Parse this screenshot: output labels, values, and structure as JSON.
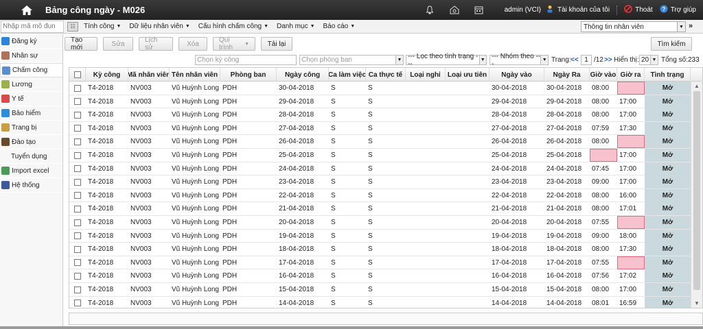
{
  "title": "Bảng công ngày - M026",
  "user": "admin (VCI)",
  "account_label": "Tài khoản của tôi",
  "logout_label": "Thoát",
  "help_label": "Trợ giúp",
  "code_placeholder": "Nhập mã mô đun",
  "menus": [
    "Tính công",
    "Dữ liệu nhân viên",
    "Cấu hình chấm công",
    "Danh mục",
    "Báo cáo"
  ],
  "info_select": "Thông tin nhân viên",
  "sidebar": [
    {
      "label": "Đăng ký",
      "icon": "register-icon",
      "color": "#2a86d8"
    },
    {
      "label": "Nhân sự",
      "icon": "personnel-icon",
      "color": "#b0735a"
    },
    {
      "label": "Chấm công",
      "icon": "timekeeping-icon",
      "color": "#5a8fcf",
      "active": true
    },
    {
      "label": "Lương",
      "icon": "salary-icon",
      "color": "#9bb04a"
    },
    {
      "label": "Y tế",
      "icon": "medical-icon",
      "color": "#d94a4a"
    },
    {
      "label": "Bảo hiểm",
      "icon": "insurance-icon",
      "color": "#2a8fd8"
    },
    {
      "label": "Trang bị",
      "icon": "equipment-icon",
      "color": "#c8a040"
    },
    {
      "label": "Đào tạo",
      "icon": "training-icon",
      "color": "#6a4a2a"
    },
    {
      "label": "Tuyển dụng",
      "icon": "",
      "color": ""
    },
    {
      "label": "Import excel",
      "icon": "import-excel-icon",
      "color": "#4a9a5a"
    },
    {
      "label": "Hệ thống",
      "icon": "system-icon",
      "color": "#3a5a9a"
    }
  ],
  "toolbar": {
    "new": "Tạo mới",
    "edit": "Sửa",
    "history": "Lịch sử",
    "delete": "Xóa",
    "workflow": "Qui trình",
    "reload": "Tải lại",
    "search": "Tìm kiếm"
  },
  "filters": {
    "period_placeholder": "Chọn kỳ công",
    "dept_placeholder": "Chọn phòng ban",
    "status_filter": "--- Lọc theo tình trạng ---",
    "group_by": "--- Nhóm theo ---",
    "page_label": "Trang:",
    "first": "<<",
    "page": "1",
    "page_total": "/12",
    "next": ">>",
    "show_label": "Hiển thị:",
    "page_size": "20",
    "total_label": "Tổng số:",
    "total": "233"
  },
  "columns": [
    "",
    "Kỳ công",
    "Mã nhân viên",
    "Tên nhân viên",
    "Phòng ban",
    "Ngày công",
    "Ca làm việc",
    "Ca thực tế",
    "Loại nghỉ",
    "Loại ưu tiên",
    "Ngày vào",
    "Ngày Ra",
    "Giờ vào",
    "Giờ ra",
    "Tình trạng"
  ],
  "rows": [
    {
      "period": "T4-2018",
      "emp": "NV003",
      "name": "Vũ Huỳnh Long",
      "dept": "PDH",
      "day": "30-04-2018",
      "shift": "S",
      "actual": "S",
      "in_date": "30-04-2018",
      "out_date": "30-04-2018",
      "in": "08:00",
      "out": "",
      "status": "Mở"
    },
    {
      "period": "T4-2018",
      "emp": "NV003",
      "name": "Vũ Huỳnh Long",
      "dept": "PDH",
      "day": "29-04-2018",
      "shift": "S",
      "actual": "S",
      "in_date": "29-04-2018",
      "out_date": "29-04-2018",
      "in": "08:00",
      "out": "17:00",
      "status": "Mở"
    },
    {
      "period": "T4-2018",
      "emp": "NV003",
      "name": "Vũ Huỳnh Long",
      "dept": "PDH",
      "day": "28-04-2018",
      "shift": "S",
      "actual": "S",
      "in_date": "28-04-2018",
      "out_date": "28-04-2018",
      "in": "08:00",
      "out": "17:00",
      "status": "Mở"
    },
    {
      "period": "T4-2018",
      "emp": "NV003",
      "name": "Vũ Huỳnh Long",
      "dept": "PDH",
      "day": "27-04-2018",
      "shift": "S",
      "actual": "S",
      "in_date": "27-04-2018",
      "out_date": "27-04-2018",
      "in": "07:59",
      "out": "17:30",
      "status": "Mở"
    },
    {
      "period": "T4-2018",
      "emp": "NV003",
      "name": "Vũ Huỳnh Long",
      "dept": "PDH",
      "day": "26-04-2018",
      "shift": "S",
      "actual": "S",
      "in_date": "26-04-2018",
      "out_date": "26-04-2018",
      "in": "08:00",
      "out": "",
      "status": "Mở"
    },
    {
      "period": "T4-2018",
      "emp": "NV003",
      "name": "Vũ Huỳnh Long",
      "dept": "PDH",
      "day": "25-04-2018",
      "shift": "S",
      "actual": "S",
      "in_date": "25-04-2018",
      "out_date": "25-04-2018",
      "in": "",
      "out": "17:00",
      "status": "Mở"
    },
    {
      "period": "T4-2018",
      "emp": "NV003",
      "name": "Vũ Huỳnh Long",
      "dept": "PDH",
      "day": "24-04-2018",
      "shift": "S",
      "actual": "S",
      "in_date": "24-04-2018",
      "out_date": "24-04-2018",
      "in": "07:45",
      "out": "17:00",
      "status": "Mở"
    },
    {
      "period": "T4-2018",
      "emp": "NV003",
      "name": "Vũ Huỳnh Long",
      "dept": "PDH",
      "day": "23-04-2018",
      "shift": "S",
      "actual": "S",
      "in_date": "23-04-2018",
      "out_date": "23-04-2018",
      "in": "09:00",
      "out": "17:00",
      "status": "Mở"
    },
    {
      "period": "T4-2018",
      "emp": "NV003",
      "name": "Vũ Huỳnh Long",
      "dept": "PDH",
      "day": "22-04-2018",
      "shift": "S",
      "actual": "S",
      "in_date": "22-04-2018",
      "out_date": "22-04-2018",
      "in": "08:00",
      "out": "16:00",
      "status": "Mở"
    },
    {
      "period": "T4-2018",
      "emp": "NV003",
      "name": "Vũ Huỳnh Long",
      "dept": "PDH",
      "day": "21-04-2018",
      "shift": "S",
      "actual": "S",
      "in_date": "21-04-2018",
      "out_date": "21-04-2018",
      "in": "08:00",
      "out": "17:01",
      "status": "Mở"
    },
    {
      "period": "T4-2018",
      "emp": "NV003",
      "name": "Vũ Huỳnh Long",
      "dept": "PDH",
      "day": "20-04-2018",
      "shift": "S",
      "actual": "S",
      "in_date": "20-04-2018",
      "out_date": "20-04-2018",
      "in": "07:55",
      "out": "",
      "status": "Mở"
    },
    {
      "period": "T4-2018",
      "emp": "NV003",
      "name": "Vũ Huỳnh Long",
      "dept": "PDH",
      "day": "19-04-2018",
      "shift": "S",
      "actual": "S",
      "in_date": "19-04-2018",
      "out_date": "19-04-2018",
      "in": "09:00",
      "out": "18:00",
      "status": "Mở"
    },
    {
      "period": "T4-2018",
      "emp": "NV003",
      "name": "Vũ Huỳnh Long",
      "dept": "PDH",
      "day": "18-04-2018",
      "shift": "S",
      "actual": "S",
      "in_date": "18-04-2018",
      "out_date": "18-04-2018",
      "in": "08:00",
      "out": "17:30",
      "status": "Mở"
    },
    {
      "period": "T4-2018",
      "emp": "NV003",
      "name": "Vũ Huỳnh Long",
      "dept": "PDH",
      "day": "17-04-2018",
      "shift": "S",
      "actual": "S",
      "in_date": "17-04-2018",
      "out_date": "17-04-2018",
      "in": "07:55",
      "out": "",
      "status": "Mở"
    },
    {
      "period": "T4-2018",
      "emp": "NV003",
      "name": "Vũ Huỳnh Long",
      "dept": "PDH",
      "day": "16-04-2018",
      "shift": "S",
      "actual": "S",
      "in_date": "16-04-2018",
      "out_date": "16-04-2018",
      "in": "07:56",
      "out": "17:02",
      "status": "Mở"
    },
    {
      "period": "T4-2018",
      "emp": "NV003",
      "name": "Vũ Huỳnh Long",
      "dept": "PDH",
      "day": "15-04-2018",
      "shift": "S",
      "actual": "S",
      "in_date": "15-04-2018",
      "out_date": "15-04-2018",
      "in": "08:00",
      "out": "17:00",
      "status": "Mở"
    },
    {
      "period": "T4-2018",
      "emp": "NV003",
      "name": "Vũ Huỳnh Long",
      "dept": "PDH",
      "day": "14-04-2018",
      "shift": "S",
      "actual": "S",
      "in_date": "14-04-2018",
      "out_date": "14-04-2018",
      "in": "08:01",
      "out": "16:59",
      "status": "Mở"
    }
  ]
}
